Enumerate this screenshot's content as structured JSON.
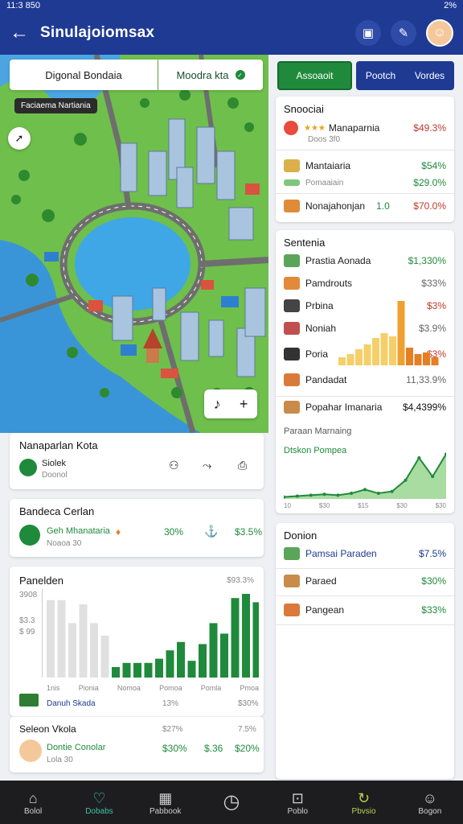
{
  "status": {
    "time": "11:3 850",
    "battery": "2%"
  },
  "appbar": {
    "title": "Sinulajoiomsax"
  },
  "map": {
    "search_text": "Digonal Bondaia",
    "filter_text": "Moodra kta",
    "tag_text": "Faciaema Nartiania"
  },
  "card_city": {
    "title": "Nanaparlan Kota",
    "item": "Siolek",
    "item_sub": "Doonol"
  },
  "card_budget": {
    "title": "Bandeca Cerlan",
    "item": "Geh Mhanataria",
    "item_sub": "Noaoa 30",
    "val1": "30%",
    "val2": "$3.5%"
  },
  "card_chart": {
    "title": "Panelden",
    "value_top": "$93.3%",
    "y1": "3908",
    "y2": "$3.3",
    "y3": "$ 99",
    "xticks": [
      "1nis",
      "Pionia",
      "Nomoa",
      "Pomoa",
      "Pomla",
      "Pmoa"
    ],
    "legend_label": "Danuh Skada",
    "legend_v1": "13%",
    "legend_v2": "$30%"
  },
  "chart_data": [
    {
      "type": "bar",
      "title": "Panelden",
      "categories": [
        "1nis",
        "Pionia",
        "Nomoa",
        "Pomoa",
        "Pomla",
        "Pmoa"
      ],
      "series": [
        {
          "name": "",
          "values": [
            74,
            74,
            52,
            70,
            52,
            40,
            10,
            14,
            14,
            14,
            18,
            26,
            34,
            16,
            32,
            52,
            42,
            76,
            80,
            72
          ]
        }
      ]
    },
    {
      "type": "line",
      "title": "Paraan Marnaing",
      "series": [
        {
          "name": "",
          "values": [
            2,
            3,
            4,
            5,
            4,
            6,
            10,
            6,
            8,
            20,
            44,
            24,
            48
          ]
        }
      ]
    }
  ],
  "card_village": {
    "title": "Seleon Vkola",
    "sub_a": "$27%",
    "sub_b": "7.5%",
    "item": "Dontie Conolar",
    "item_sub": "Lola 30",
    "v1": "$30%",
    "v2": "$.36",
    "v3": "$20%"
  },
  "tabs": {
    "left": "Assoaoit",
    "right_a": "Pootch",
    "right_b": "Vordes"
  },
  "card_snooc": {
    "title": "Snoociai",
    "rows": [
      {
        "label": "Manaparnia",
        "sub": "Doos 3f0",
        "value": "$49.3%"
      },
      {
        "label": "Mantaiaria",
        "sub": "Pomaaiain",
        "value": "$54%",
        "value2": "$29.0%"
      },
      {
        "label": "Nonajahonjan",
        "mid": "1.0",
        "value": "$70.0%"
      }
    ]
  },
  "card_sentenia": {
    "title": "Sentenia",
    "rows": [
      {
        "label": "Prastia Aonada",
        "value": "$1,330%"
      },
      {
        "label": "Pamdrouts",
        "value": "$33%"
      },
      {
        "label": "Prbina",
        "value": "$3%"
      },
      {
        "label": "Noniah",
        "value": "$3.9%"
      },
      {
        "label": "Poria",
        "value": "$3%"
      },
      {
        "label": "Pandadat",
        "value": "11,33.9%"
      },
      {
        "label": "Popahar Imanaria",
        "value": "$4,4399%"
      }
    ],
    "sub_title": "Paraan Marnaing",
    "legend": "Dtskon Pompea",
    "xticks": [
      "10",
      "$30",
      "$15",
      "$30",
      "$30"
    ]
  },
  "card_donion": {
    "title": "Donion",
    "rows": [
      {
        "label": "Pamsai Paraden",
        "value": "$7.5%"
      },
      {
        "label": "Paraed",
        "value": "$30%"
      },
      {
        "label": "Pangean",
        "value": "$33%"
      }
    ]
  },
  "nav": [
    "Bolol",
    "Dobabs",
    "Pabbook",
    "",
    "Poblo",
    "Pbvsio",
    "Bogon"
  ]
}
